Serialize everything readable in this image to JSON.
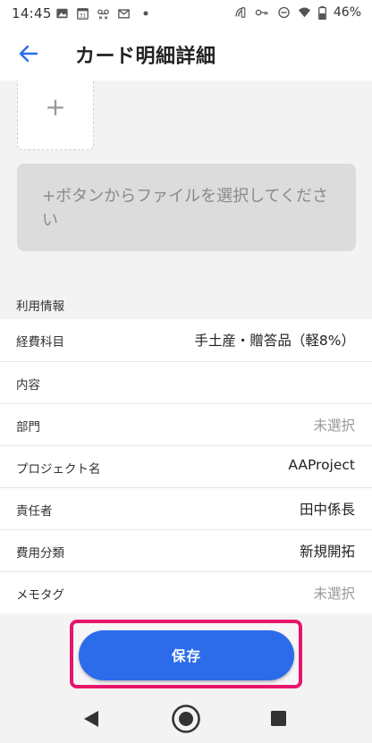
{
  "status_bar": {
    "time": "14:45",
    "battery": "46%",
    "icons": [
      "image-icon",
      "calendar-31-icon",
      "voicemail-icon",
      "gmail-icon",
      "dot-icon",
      "nfc-icon",
      "key-icon",
      "do-not-disturb-icon",
      "wifi-icon",
      "battery-icon"
    ]
  },
  "app_bar": {
    "title": "カード明細詳細",
    "back_icon": "arrow-left-icon"
  },
  "attachment": {
    "add_icon": "plus-icon",
    "add_symbol": "+",
    "hint": "+ボタンからファイルを選択してください"
  },
  "usage_info": {
    "section_title": "利用情報",
    "rows": [
      {
        "label": "経費科目",
        "value": "手土産・贈答品（軽8%）",
        "placeholder": false
      },
      {
        "label": "内容",
        "value": "",
        "placeholder": false
      },
      {
        "label": "部門",
        "value": "未選択",
        "placeholder": true
      },
      {
        "label": "プロジェクト名",
        "value": "AAProject",
        "placeholder": false
      },
      {
        "label": "責任者",
        "value": "田中係長",
        "placeholder": false
      },
      {
        "label": "費用分類",
        "value": "新規開拓",
        "placeholder": false
      },
      {
        "label": "メモタグ",
        "value": "未選択",
        "placeholder": true
      }
    ]
  },
  "save_button": {
    "label": "保存"
  },
  "colors": {
    "accent": "#2c6ceb",
    "highlight": "#e8156b",
    "placeholder_text": "#9a9a9a"
  },
  "nav_bar": {
    "icons": [
      "back-triangle-icon",
      "home-circle-icon",
      "recents-square-icon"
    ]
  }
}
